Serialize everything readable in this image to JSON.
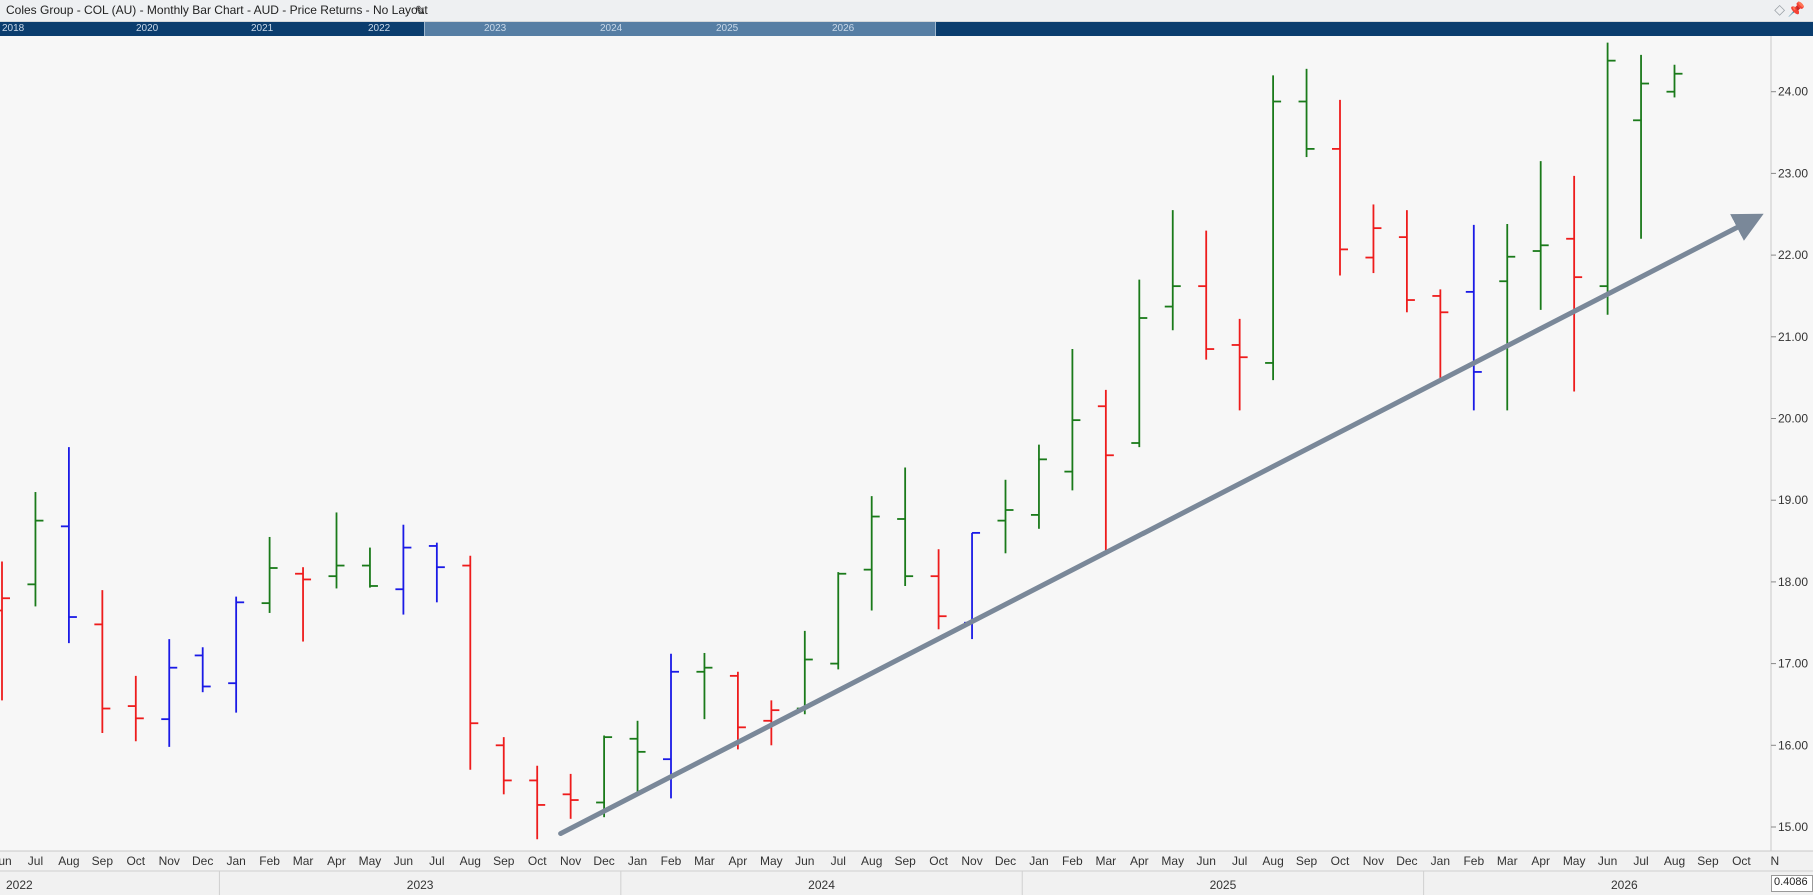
{
  "title": "Coles Group - COL (AU) - Monthly Bar Chart - AUD - Price Returns - No Layout",
  "icons": {
    "edit": "pencil-icon",
    "diamond": "diamond-icon",
    "pin": "pin-icon"
  },
  "navigator": {
    "years": [
      "2018",
      "2020",
      "2021",
      "2022",
      "2023",
      "2024",
      "2025",
      "2026"
    ]
  },
  "last_price_label": "0.4086",
  "colors": {
    "up": "#1a7a1a",
    "down": "#ee1c1c",
    "neutral": "#1a1ae6",
    "trendline": "#7a8899",
    "nav": "#0b3d6e"
  },
  "chart_data": {
    "type": "ohlc-bar",
    "y_ticks": [
      "15.00",
      "16.00",
      "17.00",
      "18.00",
      "19.00",
      "20.00",
      "21.00",
      "22.00",
      "23.00",
      "24.00"
    ],
    "ylim": [
      14.7,
      24.85
    ],
    "grid": false,
    "years": [
      {
        "label": "2022"
      },
      {
        "label": "2023"
      },
      {
        "label": "2024"
      },
      {
        "label": "2025"
      },
      {
        "label": "2026"
      }
    ],
    "bars": [
      {
        "month": "Jun",
        "o": 17.65,
        "h": 18.25,
        "l": 16.55,
        "c": 17.8,
        "color": "down"
      },
      {
        "month": "Jul",
        "o": 17.97,
        "h": 19.1,
        "l": 17.7,
        "c": 18.75,
        "color": "up"
      },
      {
        "month": "Aug",
        "o": 18.68,
        "h": 19.65,
        "l": 17.25,
        "c": 17.57,
        "color": "neutral"
      },
      {
        "month": "Sep",
        "o": 17.48,
        "h": 17.9,
        "l": 16.15,
        "c": 16.45,
        "color": "down"
      },
      {
        "month": "Oct",
        "o": 16.48,
        "h": 16.85,
        "l": 16.05,
        "c": 16.33,
        "color": "down"
      },
      {
        "month": "Nov",
        "o": 16.32,
        "h": 17.3,
        "l": 15.98,
        "c": 16.95,
        "color": "neutral"
      },
      {
        "month": "Dec",
        "o": 17.1,
        "h": 17.2,
        "l": 16.65,
        "c": 16.72,
        "color": "neutral"
      },
      {
        "month": "Jan",
        "o": 16.76,
        "h": 17.82,
        "l": 16.4,
        "c": 17.75,
        "color": "neutral"
      },
      {
        "month": "Feb",
        "o": 17.74,
        "h": 18.55,
        "l": 17.62,
        "c": 18.17,
        "color": "up"
      },
      {
        "month": "Mar",
        "o": 18.1,
        "h": 18.18,
        "l": 17.27,
        "c": 18.03,
        "color": "down"
      },
      {
        "month": "Apr",
        "o": 18.07,
        "h": 18.85,
        "l": 17.92,
        "c": 18.2,
        "color": "up"
      },
      {
        "month": "May",
        "o": 18.2,
        "h": 18.42,
        "l": 17.93,
        "c": 17.95,
        "color": "up"
      },
      {
        "month": "Jun",
        "o": 17.91,
        "h": 18.7,
        "l": 17.6,
        "c": 18.42,
        "color": "neutral"
      },
      {
        "month": "Jul",
        "o": 18.44,
        "h": 18.48,
        "l": 17.75,
        "c": 18.18,
        "color": "neutral"
      },
      {
        "month": "Aug",
        "o": 18.2,
        "h": 18.32,
        "l": 15.7,
        "c": 16.27,
        "color": "down"
      },
      {
        "month": "Sep",
        "o": 16.0,
        "h": 16.1,
        "l": 15.4,
        "c": 15.57,
        "color": "down"
      },
      {
        "month": "Oct",
        "o": 15.57,
        "h": 15.75,
        "l": 14.85,
        "c": 15.27,
        "color": "down"
      },
      {
        "month": "Nov",
        "o": 15.4,
        "h": 15.65,
        "l": 15.1,
        "c": 15.33,
        "color": "down"
      },
      {
        "month": "Dec",
        "o": 15.3,
        "h": 16.12,
        "l": 15.12,
        "c": 16.1,
        "color": "up"
      },
      {
        "month": "Jan",
        "o": 16.08,
        "h": 16.3,
        "l": 15.42,
        "c": 15.92,
        "color": "up"
      },
      {
        "month": "Feb",
        "o": 15.83,
        "h": 17.12,
        "l": 15.35,
        "c": 16.9,
        "color": "neutral"
      },
      {
        "month": "Mar",
        "o": 16.9,
        "h": 17.13,
        "l": 16.32,
        "c": 16.95,
        "color": "up"
      },
      {
        "month": "Apr",
        "o": 16.85,
        "h": 16.9,
        "l": 15.95,
        "c": 16.22,
        "color": "down"
      },
      {
        "month": "May",
        "o": 16.3,
        "h": 16.55,
        "l": 16.0,
        "c": 16.43,
        "color": "down"
      },
      {
        "month": "Jun",
        "o": 16.45,
        "h": 17.4,
        "l": 16.38,
        "c": 17.05,
        "color": "up"
      },
      {
        "month": "Jul",
        "o": 17.0,
        "h": 18.12,
        "l": 16.93,
        "c": 18.1,
        "color": "up"
      },
      {
        "month": "Aug",
        "o": 18.15,
        "h": 19.05,
        "l": 17.65,
        "c": 18.8,
        "color": "up"
      },
      {
        "month": "Sep",
        "o": 18.77,
        "h": 19.4,
        "l": 17.95,
        "c": 18.07,
        "color": "up"
      },
      {
        "month": "Oct",
        "o": 18.07,
        "h": 18.4,
        "l": 17.42,
        "c": 17.58,
        "color": "down"
      },
      {
        "month": "Nov",
        "o": 17.5,
        "h": 18.6,
        "l": 17.3,
        "c": 18.6,
        "color": "neutral"
      },
      {
        "month": "Dec",
        "o": 18.75,
        "h": 19.25,
        "l": 18.35,
        "c": 18.88,
        "color": "up"
      },
      {
        "month": "Jan",
        "o": 18.82,
        "h": 19.68,
        "l": 18.65,
        "c": 19.5,
        "color": "up"
      },
      {
        "month": "Feb",
        "o": 19.35,
        "h": 20.85,
        "l": 19.12,
        "c": 19.98,
        "color": "up"
      },
      {
        "month": "Mar",
        "o": 20.15,
        "h": 20.35,
        "l": 18.33,
        "c": 19.55,
        "color": "down"
      },
      {
        "month": "Apr",
        "o": 19.7,
        "h": 21.7,
        "l": 19.65,
        "c": 21.23,
        "color": "up"
      },
      {
        "month": "May",
        "o": 21.37,
        "h": 22.55,
        "l": 21.08,
        "c": 21.62,
        "color": "up"
      },
      {
        "month": "Jun",
        "o": 21.62,
        "h": 22.3,
        "l": 20.72,
        "c": 20.85,
        "color": "down"
      },
      {
        "month": "Jul",
        "o": 20.9,
        "h": 21.22,
        "l": 20.1,
        "c": 20.75,
        "color": "down"
      },
      {
        "month": "Aug",
        "o": 20.68,
        "h": 24.2,
        "l": 20.47,
        "c": 23.88,
        "color": "up"
      },
      {
        "month": "Sep",
        "o": 23.88,
        "h": 24.28,
        "l": 23.2,
        "c": 23.3,
        "color": "up"
      },
      {
        "month": "Oct",
        "o": 23.3,
        "h": 23.9,
        "l": 21.75,
        "c": 22.07,
        "color": "down"
      },
      {
        "month": "Nov",
        "o": 21.97,
        "h": 22.62,
        "l": 21.78,
        "c": 22.33,
        "color": "down"
      },
      {
        "month": "Dec",
        "o": 22.22,
        "h": 22.55,
        "l": 21.3,
        "c": 21.45,
        "color": "down"
      },
      {
        "month": "Jan",
        "o": 21.5,
        "h": 21.58,
        "l": 20.45,
        "c": 21.3,
        "color": "down"
      },
      {
        "month": "Feb",
        "o": 21.55,
        "h": 22.37,
        "l": 20.1,
        "c": 20.57,
        "color": "neutral"
      },
      {
        "month": "Mar",
        "o": 21.68,
        "h": 22.38,
        "l": 20.1,
        "c": 21.98,
        "color": "up"
      },
      {
        "month": "Apr",
        "o": 22.05,
        "h": 23.15,
        "l": 21.33,
        "c": 22.12,
        "color": "up"
      },
      {
        "month": "May",
        "o": 22.2,
        "h": 22.97,
        "l": 20.33,
        "c": 21.73,
        "color": "down"
      },
      {
        "month": "Jun",
        "o": 21.62,
        "h": 24.6,
        "l": 21.27,
        "c": 24.38,
        "color": "up"
      },
      {
        "month": "Jul",
        "o": 23.65,
        "h": 24.45,
        "l": 22.2,
        "c": 24.1,
        "color": "up"
      },
      {
        "month": "Aug",
        "o": 24.0,
        "h": 24.33,
        "l": 23.93,
        "c": 24.22,
        "color": "up"
      }
    ],
    "future_months": [
      "Sep",
      "Oct",
      "N"
    ],
    "trendline": {
      "from": {
        "bar_index": 16.7,
        "y": 14.92
      },
      "to": {
        "bar_index": 52.4,
        "y": 22.45
      }
    }
  }
}
